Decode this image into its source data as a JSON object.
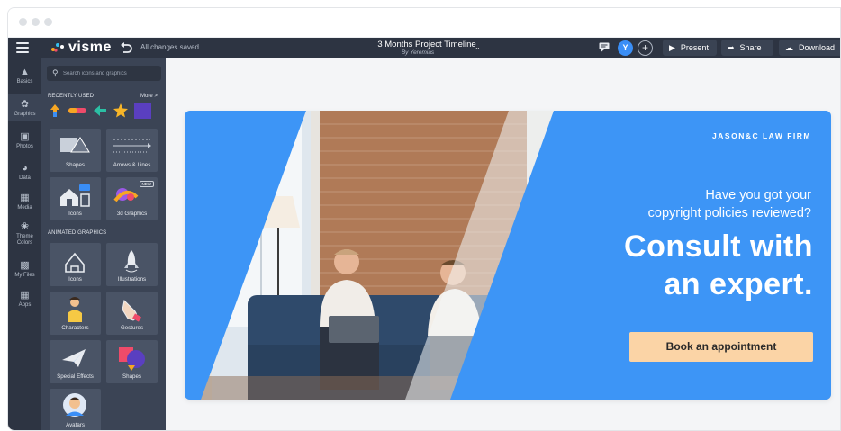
{
  "app": {
    "logo_text": "visme",
    "save_status": "All changes saved",
    "document_title": "3 Months Project Timeline",
    "document_author": "By Yeremias",
    "user_initial": "Y",
    "present_label": "Present",
    "share_label": "Share",
    "download_label": "Download"
  },
  "rail": {
    "items": [
      {
        "label": "Basics",
        "icon": "basics-icon"
      },
      {
        "label": "Graphics",
        "icon": "graphics-icon",
        "active": true
      },
      {
        "label": "Photos",
        "icon": "photos-icon"
      },
      {
        "label": "Data",
        "icon": "data-icon"
      },
      {
        "label": "Media",
        "icon": "media-icon"
      },
      {
        "label": "Theme Colors",
        "icon": "theme-colors-icon"
      },
      {
        "label": "My Files",
        "icon": "my-files-icon"
      },
      {
        "label": "Apps",
        "icon": "apps-icon"
      }
    ]
  },
  "panel": {
    "search_placeholder": "Search icons and graphics",
    "recently_used_label": "RECENTLY USED",
    "more_label": "More >",
    "animated_label": "ANIMATED GRAPHICS",
    "new_badge": "NEW",
    "tiles": [
      {
        "label": "Shapes"
      },
      {
        "label": "Arrows & Lines"
      },
      {
        "label": "Icons"
      },
      {
        "label": "3d Graphics"
      },
      {
        "label": "Icons"
      },
      {
        "label": "Illustrations"
      },
      {
        "label": "Characters"
      },
      {
        "label": "Gestures"
      },
      {
        "label": "Special Effects"
      },
      {
        "label": "Shapes"
      },
      {
        "label": "Avatars"
      }
    ]
  },
  "slide": {
    "firm_name": "JASON&C LAW FIRM",
    "question_line1": "Have you got your",
    "question_line2": "copyright policies reviewed?",
    "headline_line1": "Consult with",
    "headline_line2": "an expert.",
    "cta_label": "Book an appointment",
    "colors": {
      "accent_blue": "#3d95f6",
      "cta_bg": "#fbd4a6",
      "brick": "#b07a57"
    }
  }
}
